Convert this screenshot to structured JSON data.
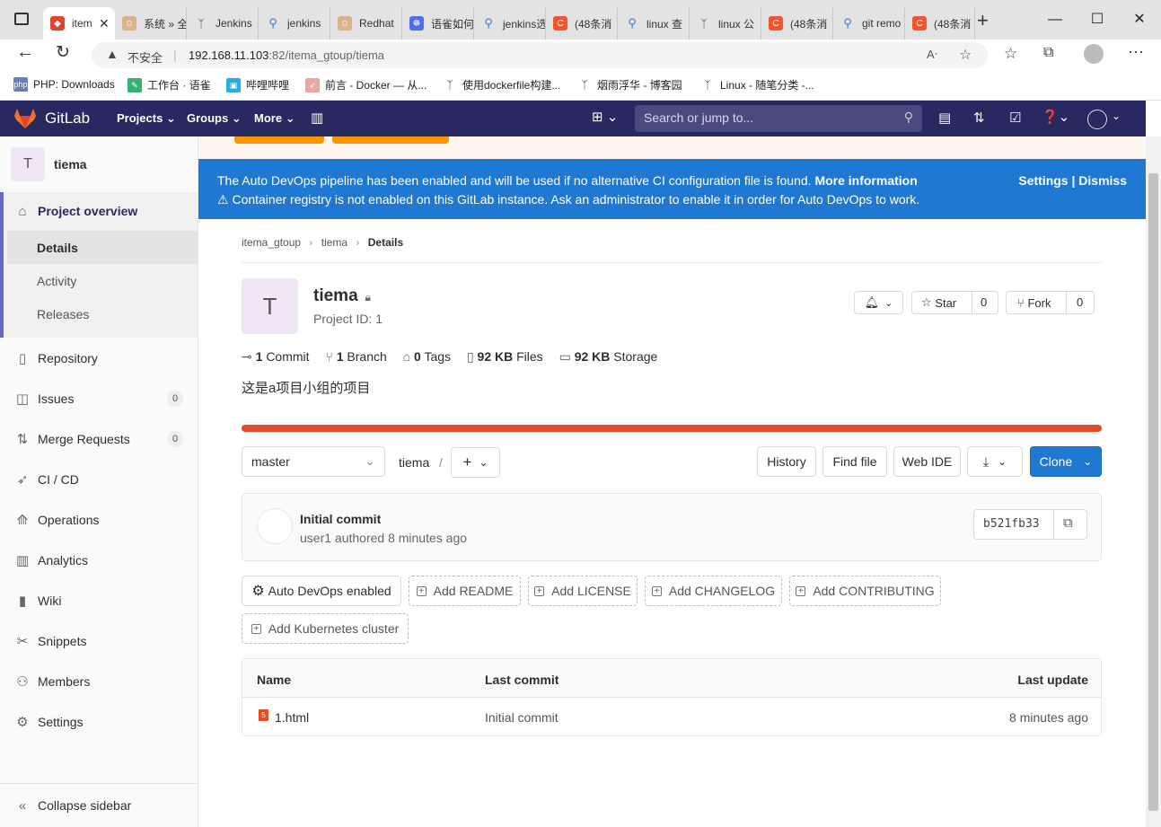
{
  "browser": {
    "tabs": [
      {
        "label": "item",
        "favicon": "gitlab-icon",
        "active": true
      },
      {
        "label": "系统 » 全",
        "favicon": "jenkins-icon"
      },
      {
        "label": "Jenkins",
        "favicon": "jenkins-icon"
      },
      {
        "label": "jenkins",
        "favicon": "search-icon"
      },
      {
        "label": "Redhat",
        "favicon": "jenkins-icon"
      },
      {
        "label": "语雀如何",
        "favicon": "baidu-icon"
      },
      {
        "label": "jenkins选",
        "favicon": "search-icon"
      },
      {
        "label": "(48条消",
        "favicon": "csdn-icon"
      },
      {
        "label": "linux 查",
        "favicon": "search-icon"
      },
      {
        "label": "linux 公",
        "favicon": "bird-icon"
      },
      {
        "label": "(48条消",
        "favicon": "csdn-icon"
      },
      {
        "label": "git remo",
        "favicon": "search-icon"
      },
      {
        "label": "(48条消",
        "favicon": "csdn-icon"
      }
    ],
    "security_label": "不安全",
    "url_host": "192.168.11.103",
    "url_rest": ":82/itema_gtoup/tiema",
    "bookmarks": [
      {
        "label": "PHP: Downloads",
        "icon": "php-icon"
      },
      {
        "label": "工作台 · 语雀",
        "icon": "yuque-icon"
      },
      {
        "label": "哔哩哔哩",
        "icon": "bilibili-icon"
      },
      {
        "label": "前言 - Docker — 从...",
        "icon": "rocket-icon"
      },
      {
        "label": "使用dockerfile构建...",
        "icon": "bird-icon"
      },
      {
        "label": "烟雨浮华 - 博客园",
        "icon": "bird-icon"
      },
      {
        "label": "Linux - 随笔分类 -...",
        "icon": "bird-icon"
      }
    ]
  },
  "header": {
    "brand": "GitLab",
    "nav": [
      "Projects",
      "Groups",
      "More"
    ],
    "search_placeholder": "Search or jump to..."
  },
  "sidebar": {
    "project_initial": "T",
    "project_name": "tiema",
    "overview": "Project overview",
    "overview_sub": [
      "Details",
      "Activity",
      "Releases"
    ],
    "items": [
      {
        "label": "Repository",
        "icon": "repository-icon"
      },
      {
        "label": "Issues",
        "icon": "issues-icon",
        "count": "0"
      },
      {
        "label": "Merge Requests",
        "icon": "merge-request-icon",
        "count": "0"
      },
      {
        "label": "CI / CD",
        "icon": "rocket-icon"
      },
      {
        "label": "Operations",
        "icon": "operations-icon"
      },
      {
        "label": "Analytics",
        "icon": "analytics-icon"
      },
      {
        "label": "Wiki",
        "icon": "wiki-icon"
      },
      {
        "label": "Snippets",
        "icon": "snippets-icon"
      },
      {
        "label": "Members",
        "icon": "members-icon"
      },
      {
        "label": "Settings",
        "icon": "settings-icon"
      }
    ],
    "collapse": "Collapse sidebar"
  },
  "banner": {
    "line1": "The Auto DevOps pipeline has been enabled and will be used if no alternative CI configuration file is found.",
    "more_info": "More information",
    "line2": "Container registry is not enabled on this GitLab instance. Ask an administrator to enable it in order for Auto DevOps to work.",
    "settings": "Settings",
    "separator": "|",
    "dismiss": "Dismiss"
  },
  "breadcrumb": [
    "itema_gtoup",
    "tiema",
    "Details"
  ],
  "project": {
    "initial": "T",
    "name": "tiema",
    "id_text": "Project ID: 1",
    "description": "这是a项目小组的项目",
    "star_label": "Star",
    "star_count": "0",
    "fork_label": "Fork",
    "fork_count": "0",
    "stats": [
      {
        "num": "1",
        "label": "Commit",
        "icon": "commit-icon"
      },
      {
        "num": "1",
        "label": "Branch",
        "icon": "branch-icon"
      },
      {
        "num": "0",
        "label": "Tags",
        "icon": "tag-icon"
      },
      {
        "num": "92 KB",
        "label": "Files",
        "icon": "file-icon"
      },
      {
        "num": "92 KB",
        "label": "Storage",
        "icon": "storage-icon"
      }
    ]
  },
  "repo_bar": {
    "branch": "master",
    "path": "tiema",
    "path_sep": "/",
    "history": "History",
    "find_file": "Find file",
    "web_ide": "Web IDE",
    "clone": "Clone"
  },
  "last_commit": {
    "title": "Initial commit",
    "author_line": "user1 authored 8 minutes ago",
    "sha": "b521fb33"
  },
  "quick_actions": {
    "auto_devops": "Auto DevOps enabled",
    "add_readme": "Add README",
    "add_license": "Add LICENSE",
    "add_changelog": "Add CHANGELOG",
    "add_contributing": "Add CONTRIBUTING",
    "add_k8s": "Add Kubernetes cluster"
  },
  "file_table": {
    "headers": [
      "Name",
      "Last commit",
      "Last update"
    ],
    "rows": [
      {
        "name": "1.html",
        "commit": "Initial commit",
        "updated": "8 minutes ago"
      }
    ]
  },
  "colors": {
    "header_bg": "#292961",
    "banner_bg": "#1f78d1",
    "clone_bg": "#1f78d1",
    "progress": "#e24329"
  }
}
